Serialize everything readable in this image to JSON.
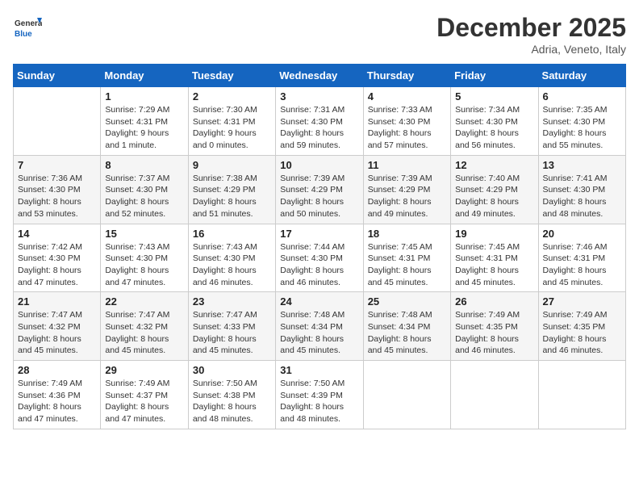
{
  "logo": {
    "general": "General",
    "blue": "Blue"
  },
  "header": {
    "month": "December 2025",
    "location": "Adria, Veneto, Italy"
  },
  "weekdays": [
    "Sunday",
    "Monday",
    "Tuesday",
    "Wednesday",
    "Thursday",
    "Friday",
    "Saturday"
  ],
  "weeks": [
    [
      {
        "day": "",
        "info": ""
      },
      {
        "day": "1",
        "info": "Sunrise: 7:29 AM\nSunset: 4:31 PM\nDaylight: 9 hours\nand 1 minute."
      },
      {
        "day": "2",
        "info": "Sunrise: 7:30 AM\nSunset: 4:31 PM\nDaylight: 9 hours\nand 0 minutes."
      },
      {
        "day": "3",
        "info": "Sunrise: 7:31 AM\nSunset: 4:30 PM\nDaylight: 8 hours\nand 59 minutes."
      },
      {
        "day": "4",
        "info": "Sunrise: 7:33 AM\nSunset: 4:30 PM\nDaylight: 8 hours\nand 57 minutes."
      },
      {
        "day": "5",
        "info": "Sunrise: 7:34 AM\nSunset: 4:30 PM\nDaylight: 8 hours\nand 56 minutes."
      },
      {
        "day": "6",
        "info": "Sunrise: 7:35 AM\nSunset: 4:30 PM\nDaylight: 8 hours\nand 55 minutes."
      }
    ],
    [
      {
        "day": "7",
        "info": "Sunrise: 7:36 AM\nSunset: 4:30 PM\nDaylight: 8 hours\nand 53 minutes."
      },
      {
        "day": "8",
        "info": "Sunrise: 7:37 AM\nSunset: 4:30 PM\nDaylight: 8 hours\nand 52 minutes."
      },
      {
        "day": "9",
        "info": "Sunrise: 7:38 AM\nSunset: 4:29 PM\nDaylight: 8 hours\nand 51 minutes."
      },
      {
        "day": "10",
        "info": "Sunrise: 7:39 AM\nSunset: 4:29 PM\nDaylight: 8 hours\nand 50 minutes."
      },
      {
        "day": "11",
        "info": "Sunrise: 7:39 AM\nSunset: 4:29 PM\nDaylight: 8 hours\nand 49 minutes."
      },
      {
        "day": "12",
        "info": "Sunrise: 7:40 AM\nSunset: 4:29 PM\nDaylight: 8 hours\nand 49 minutes."
      },
      {
        "day": "13",
        "info": "Sunrise: 7:41 AM\nSunset: 4:30 PM\nDaylight: 8 hours\nand 48 minutes."
      }
    ],
    [
      {
        "day": "14",
        "info": "Sunrise: 7:42 AM\nSunset: 4:30 PM\nDaylight: 8 hours\nand 47 minutes."
      },
      {
        "day": "15",
        "info": "Sunrise: 7:43 AM\nSunset: 4:30 PM\nDaylight: 8 hours\nand 47 minutes."
      },
      {
        "day": "16",
        "info": "Sunrise: 7:43 AM\nSunset: 4:30 PM\nDaylight: 8 hours\nand 46 minutes."
      },
      {
        "day": "17",
        "info": "Sunrise: 7:44 AM\nSunset: 4:30 PM\nDaylight: 8 hours\nand 46 minutes."
      },
      {
        "day": "18",
        "info": "Sunrise: 7:45 AM\nSunset: 4:31 PM\nDaylight: 8 hours\nand 45 minutes."
      },
      {
        "day": "19",
        "info": "Sunrise: 7:45 AM\nSunset: 4:31 PM\nDaylight: 8 hours\nand 45 minutes."
      },
      {
        "day": "20",
        "info": "Sunrise: 7:46 AM\nSunset: 4:31 PM\nDaylight: 8 hours\nand 45 minutes."
      }
    ],
    [
      {
        "day": "21",
        "info": "Sunrise: 7:47 AM\nSunset: 4:32 PM\nDaylight: 8 hours\nand 45 minutes."
      },
      {
        "day": "22",
        "info": "Sunrise: 7:47 AM\nSunset: 4:32 PM\nDaylight: 8 hours\nand 45 minutes."
      },
      {
        "day": "23",
        "info": "Sunrise: 7:47 AM\nSunset: 4:33 PM\nDaylight: 8 hours\nand 45 minutes."
      },
      {
        "day": "24",
        "info": "Sunrise: 7:48 AM\nSunset: 4:34 PM\nDaylight: 8 hours\nand 45 minutes."
      },
      {
        "day": "25",
        "info": "Sunrise: 7:48 AM\nSunset: 4:34 PM\nDaylight: 8 hours\nand 45 minutes."
      },
      {
        "day": "26",
        "info": "Sunrise: 7:49 AM\nSunset: 4:35 PM\nDaylight: 8 hours\nand 46 minutes."
      },
      {
        "day": "27",
        "info": "Sunrise: 7:49 AM\nSunset: 4:35 PM\nDaylight: 8 hours\nand 46 minutes."
      }
    ],
    [
      {
        "day": "28",
        "info": "Sunrise: 7:49 AM\nSunset: 4:36 PM\nDaylight: 8 hours\nand 47 minutes."
      },
      {
        "day": "29",
        "info": "Sunrise: 7:49 AM\nSunset: 4:37 PM\nDaylight: 8 hours\nand 47 minutes."
      },
      {
        "day": "30",
        "info": "Sunrise: 7:50 AM\nSunset: 4:38 PM\nDaylight: 8 hours\nand 48 minutes."
      },
      {
        "day": "31",
        "info": "Sunrise: 7:50 AM\nSunset: 4:39 PM\nDaylight: 8 hours\nand 48 minutes."
      },
      {
        "day": "",
        "info": ""
      },
      {
        "day": "",
        "info": ""
      },
      {
        "day": "",
        "info": ""
      }
    ]
  ]
}
